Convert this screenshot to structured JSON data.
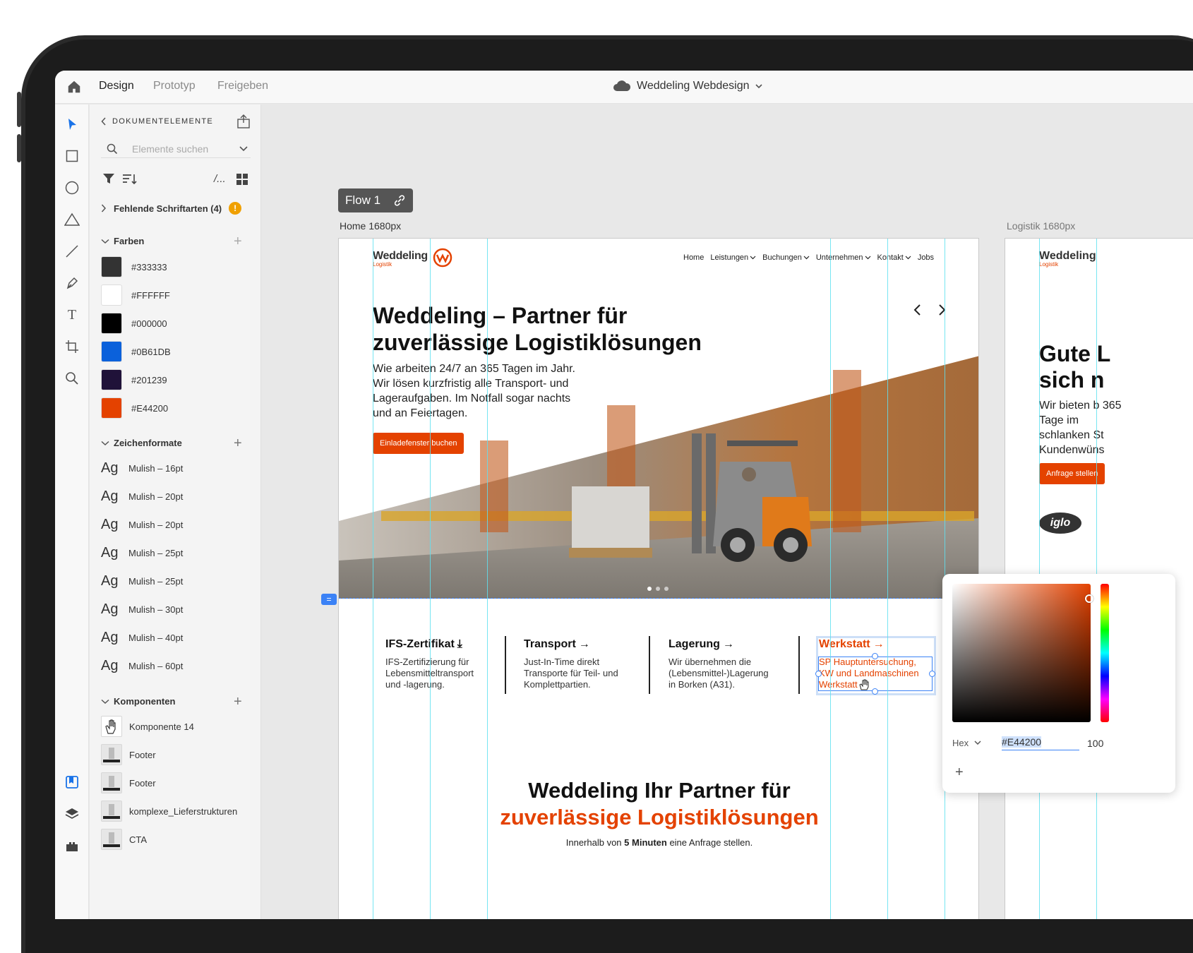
{
  "topbar": {
    "tabs": [
      "Design",
      "Prototyp",
      "Freigeben"
    ],
    "document_title": "Weddeling Webdesign"
  },
  "panel": {
    "header": "DOKUMENTELEMENTE",
    "search_placeholder": "Elemente suchen",
    "missing_fonts": "Fehlende Schriftarten (4)",
    "colors_heading": "Farben",
    "colors": [
      {
        "hex": "#333333",
        "label": "#333333"
      },
      {
        "hex": "#FFFFFF",
        "label": "#FFFFFF"
      },
      {
        "hex": "#000000",
        "label": "#000000"
      },
      {
        "hex": "#0B61DB",
        "label": "#0B61DB"
      },
      {
        "hex": "#201239",
        "label": "#201239"
      },
      {
        "hex": "#E44200",
        "label": "#E44200"
      }
    ],
    "char_heading": "Zeichenformate",
    "char_sample": "Ag",
    "char_styles": [
      "Mulish – 16pt",
      "Mulish – 20pt",
      "Mulish – 20pt",
      "Mulish – 25pt",
      "Mulish – 25pt",
      "Mulish – 30pt",
      "Mulish – 40pt",
      "Mulish – 60pt"
    ],
    "comp_heading": "Komponenten",
    "components": [
      "Komponente 14",
      "Footer",
      "Footer",
      "komplexe_Lieferstrukturen",
      "CTA"
    ]
  },
  "canvas": {
    "flow_label": "Flow 1",
    "artboard1_label": "Home 1680px",
    "artboard2_label": "Logistik 1680px"
  },
  "site": {
    "logo": "Weddeling",
    "logo_sub": "Logistik",
    "nav": [
      "Home",
      "Leistungen",
      "Buchungen",
      "Unternehmen",
      "Kontakt",
      "Jobs"
    ],
    "hero_title": "Weddeling – Partner für zuverlässige Logistiklösungen",
    "hero_text": "Wie arbeiten 24/7 an 365 Tagen im Jahr. Wir lösen kurzfristig alle Transport- und Lageraufgaben. Im Notfall sogar nachts und an Feiertagen.",
    "hero_button": "Einladefenster buchen",
    "services": [
      {
        "title": "IFS-Zertifikat",
        "arrow": "⤓",
        "desc": "IFS-Zertifizierung für Lebensmitteltransport und -lagerung."
      },
      {
        "title": "Transport",
        "arrow": "→",
        "desc": "Just-In-Time direkt Transporte für Teil- und Komplettpartien."
      },
      {
        "title": "Lagerung",
        "arrow": "→",
        "desc": "Wir übernehmen die (Lebensmittel-)Lagerung in Borken (A31)."
      },
      {
        "title": "Werkstatt",
        "arrow": "→",
        "desc": "SP Hauptuntersuchung, KW und Landmaschinen Werkstatt"
      }
    ],
    "bottom_title_1": "Weddeling Ihr Partner für",
    "bottom_title_2": "zuverlässige Logistiklösungen",
    "bottom_sub_pre": "Innerhalb von ",
    "bottom_sub_bold": "5 Minuten",
    "bottom_sub_post": " eine Anfrage stellen.",
    "art2_title": "Gute L sich n",
    "art2_title_1": "Gute L",
    "art2_title_2": "sich n",
    "art2_text": "Wir bieten b 365 Tage im schlanken St Kundenwüns",
    "art2_button": "Anfrage stellen",
    "art2_client_logo": "iglo"
  },
  "picker": {
    "mode": "Hex",
    "value": "#E44200",
    "opacity": "100"
  },
  "colors": {
    "accent": "#E44200",
    "guide": "#5FE0F0",
    "selection": "#3B82F6"
  }
}
